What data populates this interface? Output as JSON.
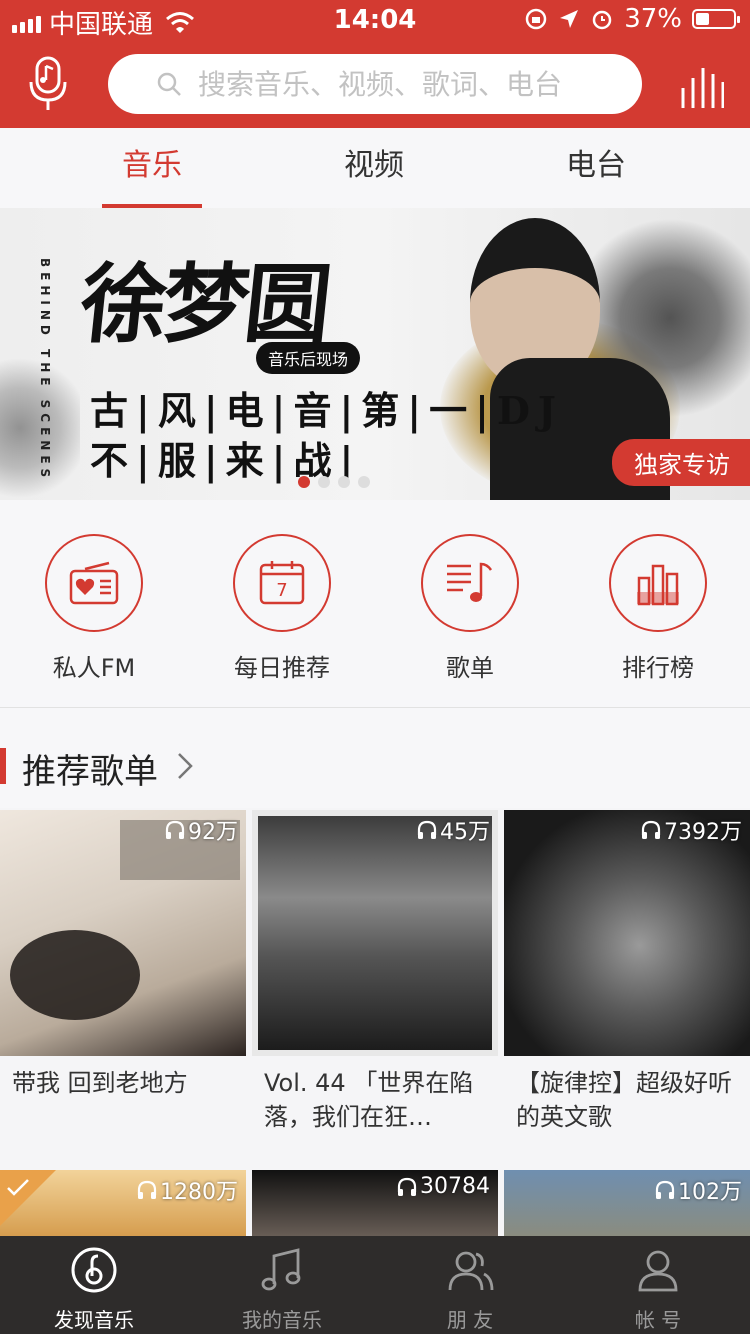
{
  "status_bar": {
    "carrier": "中国联通",
    "time": "14:04",
    "battery": "37%",
    "battery_level": 0.37
  },
  "search": {
    "placeholder": "搜索音乐、视频、歌词、电台"
  },
  "tabs": [
    {
      "label": "音乐",
      "active": true
    },
    {
      "label": "视频",
      "active": false
    },
    {
      "label": "电台",
      "active": false
    }
  ],
  "banner": {
    "side_text": "BEHIND THE SCENES",
    "name": "徐梦圆",
    "subtitle": "音乐后现场",
    "line1": "古|风|电|音|第|一|DJ",
    "line2": "不|服|来|战|",
    "tag": "独家专访",
    "page_count": 4,
    "current_page": 1
  },
  "quick_entries": [
    {
      "label": "私人FM",
      "icon": "radio-heart-icon"
    },
    {
      "label": "每日推荐",
      "icon": "calendar-icon",
      "day": "7"
    },
    {
      "label": "歌单",
      "icon": "playlist-icon"
    },
    {
      "label": "排行榜",
      "icon": "chart-bars-icon"
    }
  ],
  "section": {
    "title": "推荐歌单"
  },
  "playlists": [
    {
      "plays": "92万",
      "title": "带我  回到老地方"
    },
    {
      "plays": "45万",
      "title": "Vol. 44 「世界在陷落，我们在狂…"
    },
    {
      "plays": "7392万",
      "title": "【旋律控】超级好听的英文歌"
    },
    {
      "plays": "1280万",
      "title": ""
    },
    {
      "plays": "30784",
      "title": ""
    },
    {
      "plays": "102万",
      "title": ""
    }
  ],
  "tab_bar": [
    {
      "label": "发现音乐",
      "icon": "discover-music-icon",
      "active": true
    },
    {
      "label": "我的音乐",
      "icon": "music-note-icon",
      "active": false
    },
    {
      "label": "朋 友",
      "icon": "friends-icon",
      "active": false
    },
    {
      "label": "帐 号",
      "icon": "account-icon",
      "active": false
    }
  ],
  "colors": {
    "brand": "#d33a31",
    "tab_bar_bg": "#2e2c2b"
  }
}
